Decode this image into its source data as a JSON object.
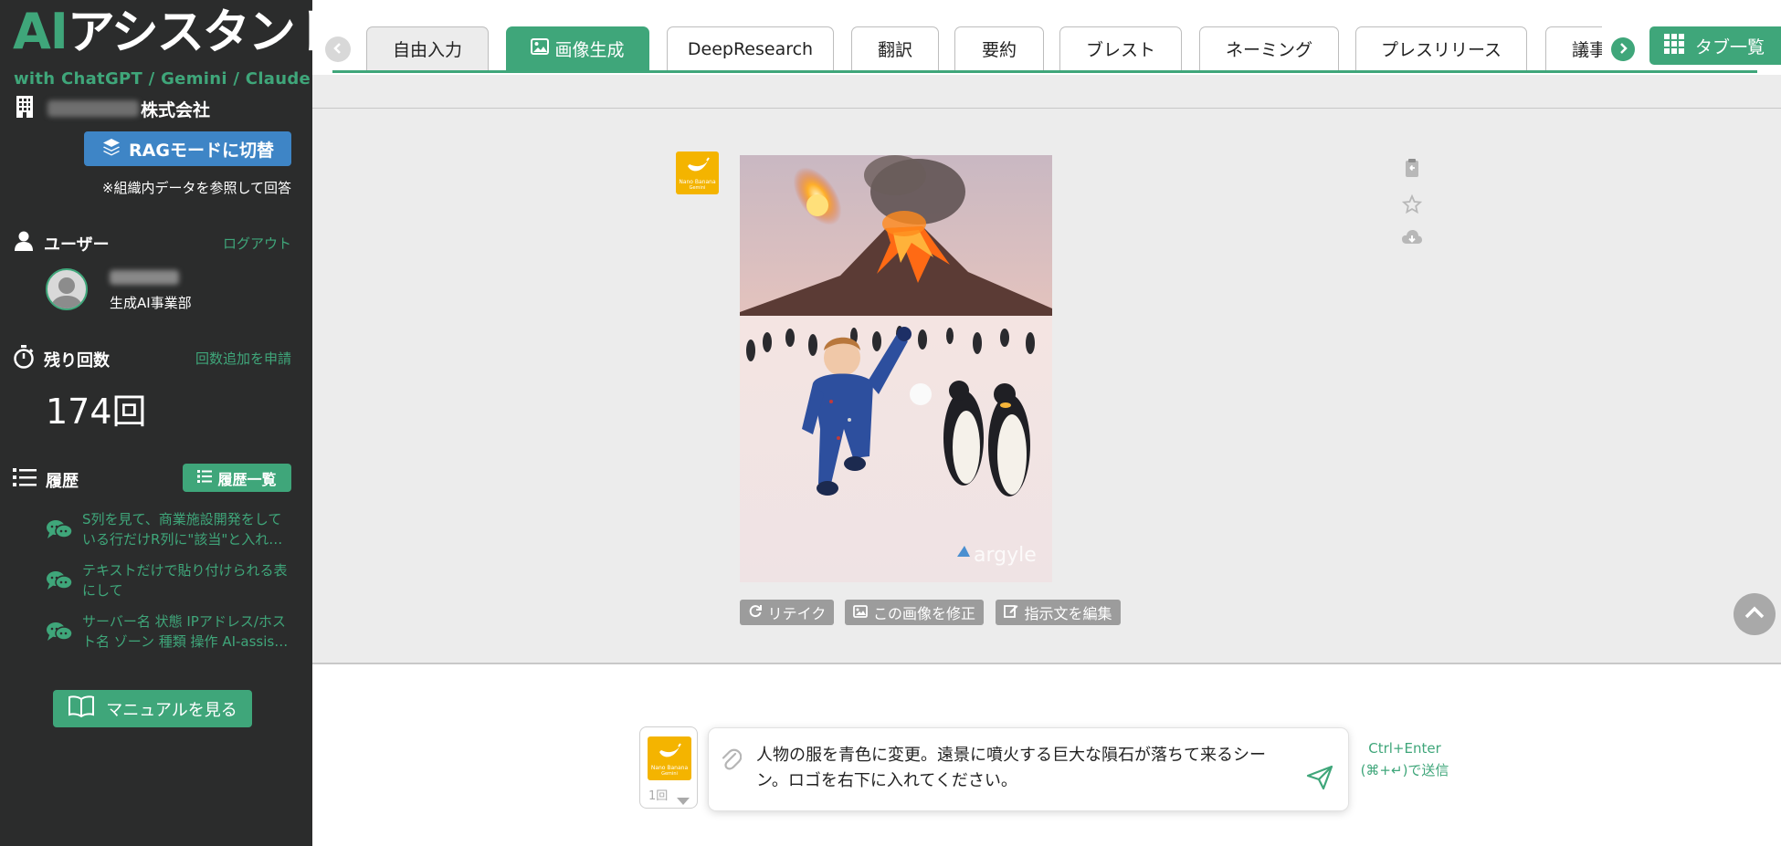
{
  "sidebar": {
    "logo_ai": "AI",
    "logo_text": "アシスタント",
    "logo_sub": "with ChatGPT / Gemini / Claude",
    "company_suffix": "株式会社",
    "rag_button": "RAGモードに切替",
    "rag_note": "※組織内データを参照して回答",
    "user_label": "ユーザー",
    "logout": "ログアウト",
    "user_dept": "生成AI事業部",
    "remaining_label": "残り回数",
    "remaining_link": "回数追加を申請",
    "remaining_count": "174回",
    "history_label": "履歴",
    "history_button": "履歴一覧",
    "history": [
      "S列を見て、商業施設開発をしている行だけR列に\"該当\"と入れ…",
      "テキストだけで貼り付けられる表にして",
      "サーバー名 状態 IPアドレス/ホスト名 ゾーン 種類 操作 AI-assis…"
    ],
    "manual_button": "マニュアルを見る"
  },
  "tabs": [
    {
      "label": "自由入力",
      "state": "gray"
    },
    {
      "label": "画像生成",
      "state": "active"
    },
    {
      "label": "DeepResearch",
      "state": "normal"
    },
    {
      "label": "翻訳",
      "state": "normal"
    },
    {
      "label": "要約",
      "state": "normal"
    },
    {
      "label": "ブレスト",
      "state": "normal"
    },
    {
      "label": "ネーミング",
      "state": "normal"
    },
    {
      "label": "プレスリリース",
      "state": "normal"
    },
    {
      "label": "議事",
      "state": "normal"
    }
  ],
  "tab_list_button": "タブ一覧",
  "result": {
    "model_badge": "Nano Banana",
    "model_badge_sub": "Gemini",
    "watermark": "argyle",
    "actions": [
      "リテイク",
      "この画像を修正",
      "指示文を編集"
    ],
    "side_icons": [
      "copy-icon",
      "star-icon",
      "download-icon"
    ]
  },
  "input": {
    "count": "1回",
    "prompt": "人物の服を青色に変更。遠景に噴火する巨大な隕石が落ちて来るシーン。ロゴを右下に入れてください。",
    "shortcut_line1": "Ctrl+Enter",
    "shortcut_line2": "(⌘+↵)で送信"
  },
  "colors": {
    "accent_green": "#3fa67a",
    "sidebar_bg": "#2b2c2c",
    "rag_blue": "#3e85c6",
    "badge_yellow": "#f4b400"
  }
}
